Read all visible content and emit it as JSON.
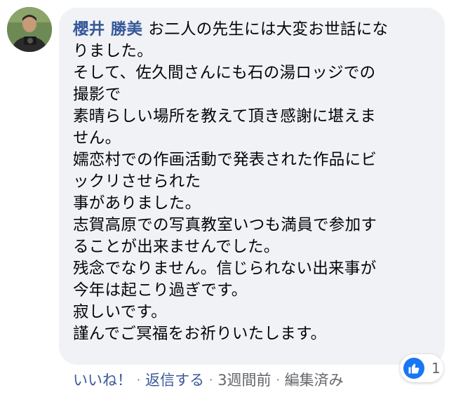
{
  "comment": {
    "author": "櫻井 勝美",
    "first_line": "お二人の先生には大変お世話にな",
    "lines": [
      "りました。",
      "そして、佐久間さんにも石の湯ロッジでの",
      "撮影で",
      "素晴らしい場所を教えて頂き感謝に堪えま",
      "せん。",
      "嬬恋村での作画活動で発表された作品にビ",
      "ックリさせられた",
      "事がありました。",
      "志賀高原での写真教室いつも満員で参加す",
      "ることが出来ませんでした。",
      "残念でなりません。信じられない出来事が",
      "今年は起こり過ぎです。",
      "寂しいです。",
      "謹んでご冥福をお祈りいたします。"
    ]
  },
  "actions": {
    "like": "いいね！",
    "reply": "返信する",
    "time": "3週間前",
    "edited": "編集済み",
    "separator": "·"
  },
  "reactions": {
    "icon": "thumbs-up-icon",
    "count": "1"
  },
  "colors": {
    "author": "#365899",
    "bubble": "#f0f2f5",
    "like_blue": "#1877f2",
    "meta_gray": "#65676b"
  }
}
